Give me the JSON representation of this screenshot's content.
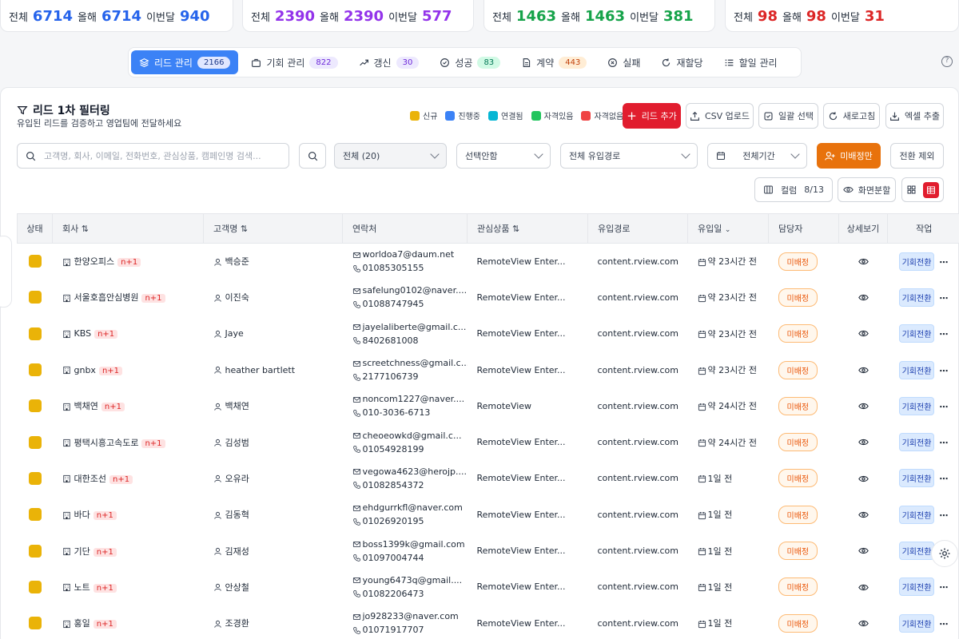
{
  "stats": [
    {
      "label_total": "전체",
      "total": "6714",
      "label_year": "올해",
      "year": "6714",
      "label_month": "이번달",
      "month": "940",
      "color": "#2563eb"
    },
    {
      "label_total": "전체",
      "total": "2390",
      "label_year": "올해",
      "year": "2390",
      "label_month": "이번달",
      "month": "577",
      "color": "#9333ea"
    },
    {
      "label_total": "전체",
      "total": "1463",
      "label_year": "올해",
      "year": "1463",
      "label_month": "이번달",
      "month": "381",
      "color": "#16a34a"
    },
    {
      "label_total": "전체",
      "total": "98",
      "label_year": "올해",
      "year": "98",
      "label_month": "이번달",
      "month": "31",
      "color": "#dc2626"
    }
  ],
  "tabs": [
    {
      "label": "리드 관리",
      "count": "2166",
      "icon": "layers-icon",
      "active": true
    },
    {
      "label": "기회 관리",
      "count": "822",
      "icon": "briefcase-icon",
      "count_bg": "#ede9fe",
      "count_fg": "#6d28d9"
    },
    {
      "label": "갱신",
      "count": "30",
      "icon": "trend-icon",
      "count_bg": "#ede9fe",
      "count_fg": "#6d28d9"
    },
    {
      "label": "성공",
      "count": "83",
      "icon": "check-circle-icon",
      "count_bg": "#d1fae5",
      "count_fg": "#047857"
    },
    {
      "label": "계약",
      "count": "443",
      "icon": "document-icon",
      "count_bg": "#ffedd5",
      "count_fg": "#c2410c"
    },
    {
      "label": "실패",
      "count": "",
      "icon": "x-circle-icon"
    },
    {
      "label": "재할당",
      "count": "",
      "icon": "refresh-icon"
    },
    {
      "label": "할일 관리",
      "count": "",
      "icon": "list-icon"
    }
  ],
  "panel": {
    "title": "리드 1차 필터링",
    "subtitle": "유입된 리드를 검증하고 영업팀에 전달하세요"
  },
  "legend": [
    {
      "label": "신규",
      "color": "#eab308"
    },
    {
      "label": "진행중",
      "color": "#3b82f6"
    },
    {
      "label": "연결됨",
      "color": "#06b6d4"
    },
    {
      "label": "자격있음",
      "color": "#22c55e"
    },
    {
      "label": "자격없음",
      "color": "#ef4444"
    }
  ],
  "actions": {
    "add_lead": "리드 추가",
    "csv_upload": "CSV 업로드",
    "bulk_select": "일괄 선택",
    "refresh": "새로고침",
    "excel_export": "엑셀 추출"
  },
  "filters": {
    "search_placeholder": "고객명, 회사, 이메일, 전화번호, 관심상품, 캠페인명 검색...",
    "status": "전체 (20)",
    "assignee": "선택안함",
    "source": "전체 유입경로",
    "period": "전체기간",
    "unassigned_only": "미배정만",
    "exclude_converted": "전환 제외"
  },
  "view": {
    "columns_label": "컬럼",
    "columns_count": "8/13",
    "split_view": "화면분할"
  },
  "table": {
    "headers": {
      "status": "상태",
      "company": "회사 ⇅",
      "customer": "고객명 ⇅",
      "contact": "연락처",
      "product": "관심상품 ⇅",
      "source": "유입경로",
      "date": "유입일",
      "owner": "담당자",
      "detail": "상세보기",
      "action": "작업"
    },
    "rows": [
      {
        "company": "한양오피스",
        "tag": "n+1",
        "customer": "백승준",
        "email": "worldoa7@daum.net",
        "phone": "01085305155",
        "product": "RemoteView Enter...",
        "source": "content.rview.com",
        "date": "약 23시간 전",
        "owner": "미배정",
        "action": "기회전환"
      },
      {
        "company": "서울호흡안심병원",
        "tag": "n+1",
        "customer": "이진숙",
        "email": "safelung0102@naver....",
        "phone": "01088747945",
        "product": "RemoteView Enter...",
        "source": "content.rview.com",
        "date": "약 23시간 전",
        "owner": "미배정",
        "action": "기회전환"
      },
      {
        "company": "KBS",
        "tag": "n+1",
        "customer": "Jaye",
        "email": "jayelaliberte@gmail.c...",
        "phone": "8402681008",
        "product": "RemoteView Enter...",
        "source": "content.rview.com",
        "date": "약 23시간 전",
        "owner": "미배정",
        "action": "기회전환"
      },
      {
        "company": "gnbx",
        "tag": "n+1",
        "customer": "heather bartlett",
        "email": "screetchness@gmail.c...",
        "phone": "2177106739",
        "product": "RemoteView Enter...",
        "source": "content.rview.com",
        "date": "약 23시간 전",
        "owner": "미배정",
        "action": "기회전환"
      },
      {
        "company": "백채연",
        "tag": "n+1",
        "customer": "백채연",
        "email": "noncom1227@naver....",
        "phone": "010-3036-6713",
        "product": "RemoteView",
        "source": "content.rview.com",
        "date": "약 24시간 전",
        "owner": "미배정",
        "action": "기회전환"
      },
      {
        "company": "평택시흥고속도로",
        "tag": "n+1",
        "customer": "김성범",
        "email": "cheoeowkd@gmail.c...",
        "phone": "01054928199",
        "product": "RemoteView Enter...",
        "source": "content.rview.com",
        "date": "약 24시간 전",
        "owner": "미배정",
        "action": "기회전환"
      },
      {
        "company": "대한조선",
        "tag": "n+1",
        "customer": "오유라",
        "email": "vegowa4623@herojp....",
        "phone": "01082854372",
        "product": "RemoteView Enter...",
        "source": "content.rview.com",
        "date": "1일 전",
        "owner": "미배정",
        "action": "기회전환"
      },
      {
        "company": "바다",
        "tag": "n+1",
        "customer": "김동혁",
        "email": "ehdgurrkfl@naver.com",
        "phone": "01026920195",
        "product": "RemoteView Enter...",
        "source": "content.rview.com",
        "date": "1일 전",
        "owner": "미배정",
        "action": "기회전환"
      },
      {
        "company": "기단",
        "tag": "n+1",
        "customer": "김재성",
        "email": "boss1399k@gmail.com",
        "phone": "01097004744",
        "product": "RemoteView Enter...",
        "source": "content.rview.com",
        "date": "1일 전",
        "owner": "미배정",
        "action": "기회전환"
      },
      {
        "company": "노트",
        "tag": "n+1",
        "customer": "안상철",
        "email": "young6473q@gmail....",
        "phone": "01082206473",
        "product": "RemoteView Enter...",
        "source": "content.rview.com",
        "date": "1일 전",
        "owner": "미배정",
        "action": "기회전환"
      },
      {
        "company": "홍일",
        "tag": "n+1",
        "customer": "조경환",
        "email": "jo928233@naver.com",
        "phone": "01071917707",
        "product": "RemoteView Enter...",
        "source": "content.rview.com",
        "date": "1일 전",
        "owner": "미배정",
        "action": "기회전환"
      }
    ]
  }
}
